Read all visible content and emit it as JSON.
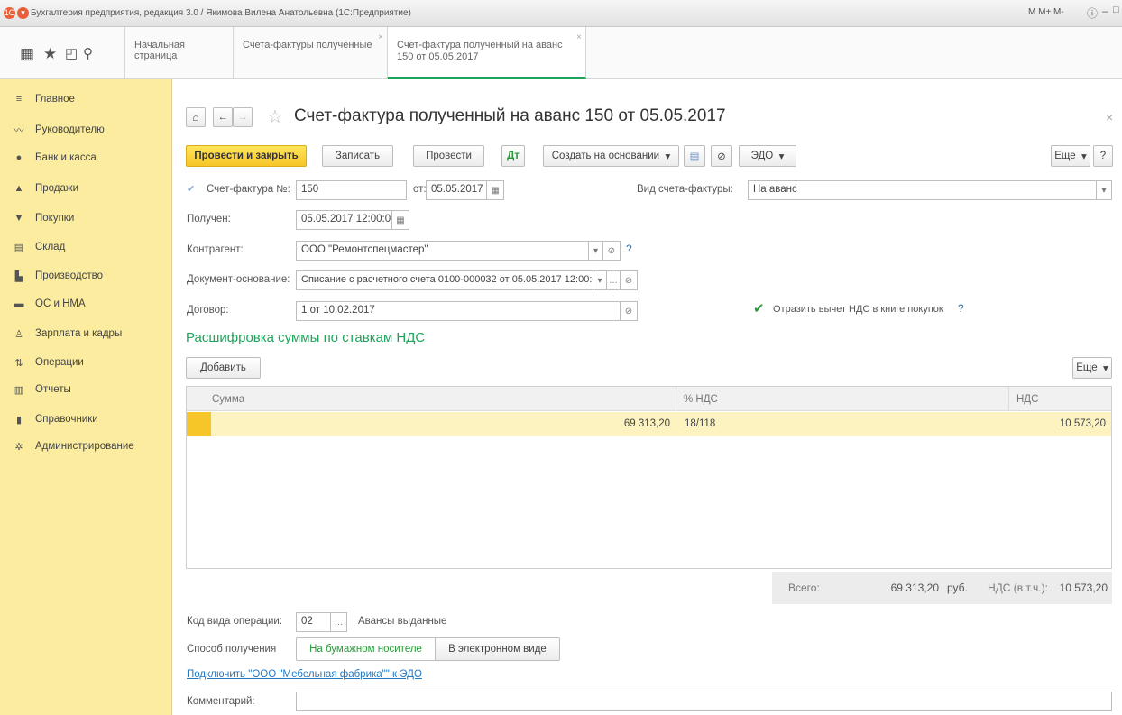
{
  "window": {
    "title": "Бухгалтерия предприятия, редакция 3.0 / Якимова Вилена Анатольевна (1С:Предприятие)",
    "toolbar_text": "M M+ M-"
  },
  "tabs": [
    {
      "label": "Начальная страница"
    },
    {
      "label": "Счета-фактуры полученные"
    },
    {
      "label": "Счет-фактура полученный на аванс 150 от 05.05.2017"
    }
  ],
  "sidebar": {
    "items": [
      {
        "label": "Главное",
        "icon": "menu-icon"
      },
      {
        "label": "Руководителю",
        "icon": "chart-line-icon"
      },
      {
        "label": "Банк и касса",
        "icon": "coins-icon"
      },
      {
        "label": "Продажи",
        "icon": "basket-icon"
      },
      {
        "label": "Покупки",
        "icon": "cart-icon"
      },
      {
        "label": "Склад",
        "icon": "warehouse-icon"
      },
      {
        "label": "Производство",
        "icon": "factory-icon"
      },
      {
        "label": "ОС и НМА",
        "icon": "truck-icon"
      },
      {
        "label": "Зарплата и кадры",
        "icon": "person-icon"
      },
      {
        "label": "Операции",
        "icon": "operations-icon"
      },
      {
        "label": "Отчеты",
        "icon": "bar-chart-icon"
      },
      {
        "label": "Справочники",
        "icon": "book-icon"
      },
      {
        "label": "Администрирование",
        "icon": "gear-icon"
      }
    ]
  },
  "doc": {
    "title": "Счет-фактура полученный на аванс 150 от 05.05.2017",
    "toolbar": {
      "post_close": "Провести и закрыть",
      "save": "Записать",
      "post": "Провести",
      "create_based": "Создать на основании",
      "edo": "ЭДО",
      "more": "Еще",
      "help": "?"
    },
    "form": {
      "invoice_no_label": "Счет-фактура №:",
      "invoice_no": "150",
      "date_label": "от:",
      "date": "05.05.2017",
      "kind_label": "Вид счета-фактуры:",
      "kind": "На аванс",
      "received_label": "Получен:",
      "received": "05.05.2017 12:00:04",
      "counterparty_label": "Контрагент:",
      "counterparty": "ООО \"Ремонтспецмастер\"",
      "basis_label": "Документ-основание:",
      "basis": "Списание с расчетного счета 0100-000032 от 05.05.2017 12:00:03",
      "contract_label": "Договор:",
      "contract": "1 от 10.02.2017",
      "vat_checkbox_label": "Отразить вычет НДС в книге покупок",
      "help": "?"
    },
    "vat_section": {
      "title": "Расшифровка суммы по ставкам НДС",
      "add_button": "Добавить",
      "more_button": "Еще",
      "columns": [
        "Сумма",
        "% НДС",
        "НДС"
      ],
      "rows": [
        {
          "sum": "69 313,20",
          "rate": "18/118",
          "vat": "10 573,20"
        }
      ]
    },
    "totals": {
      "label": "Всего:",
      "sum": "69 313,20",
      "currency": "руб.",
      "vat_label": "НДС (в т.ч.):",
      "vat": "10 573,20"
    },
    "operation": {
      "label": "Код вида операции:",
      "code": "02",
      "desc": "Авансы выданные"
    },
    "receipt": {
      "label": "Способ получения",
      "options": [
        "На бумажном носителе",
        "В электронном виде"
      ]
    },
    "edo_link": "Подключить \"ООО \"Мебельная фабрика\"\" к ЭДО",
    "comment_label": "Комментарий:",
    "comment": ""
  },
  "colors": {
    "sidebar": "#fbeca0",
    "primary_button": "#f6c629",
    "section_title": "#1fa35b",
    "selected_row": "#fcf3c1",
    "link": "#2478c0"
  }
}
